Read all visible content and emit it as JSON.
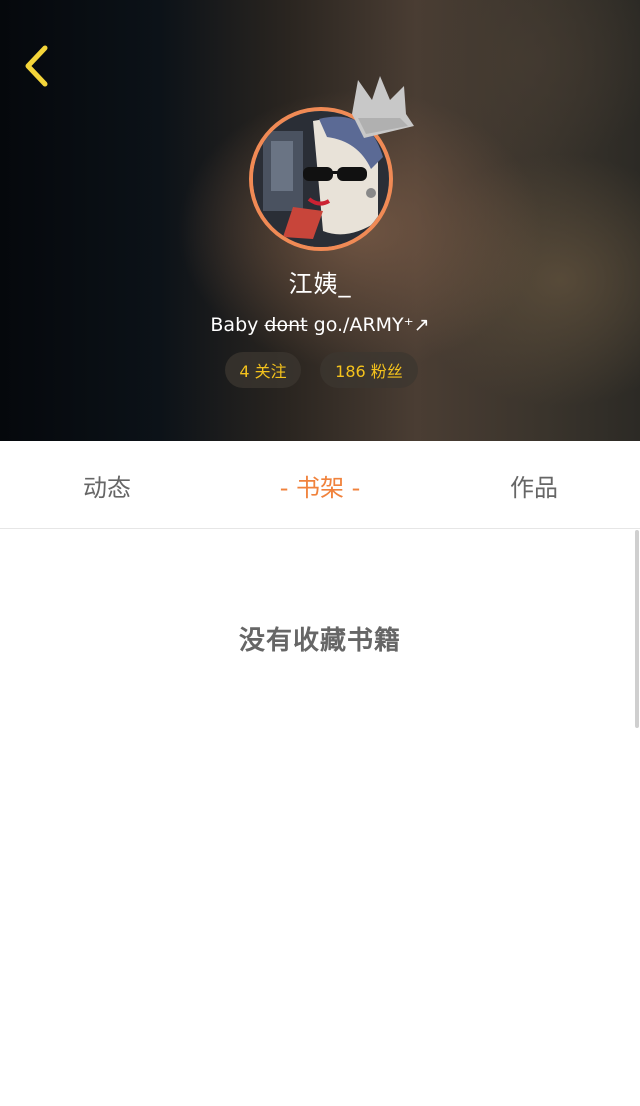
{
  "colors": {
    "accent_orange": "#f0823c",
    "avatar_border": "#f08a55",
    "stat_yellow": "#f4c21c",
    "back_icon_yellow": "#f4d53a",
    "tab_gray": "#666666"
  },
  "profile": {
    "username": "江姨_",
    "bio_struck": "dont",
    "bio_prefix": "Baby ",
    "bio_suffix": " go./ARMY⁺↗",
    "follow_label": "4 关注",
    "fans_label": "186 粉丝"
  },
  "icons": {
    "back": "chevron-left-icon",
    "crown": "crown-icon"
  },
  "tabs": [
    {
      "label": "动态"
    },
    {
      "label": "- 书架 -",
      "selected": true
    },
    {
      "label": "作品"
    }
  ],
  "shelf": {
    "empty_message": "没有收藏书籍"
  }
}
